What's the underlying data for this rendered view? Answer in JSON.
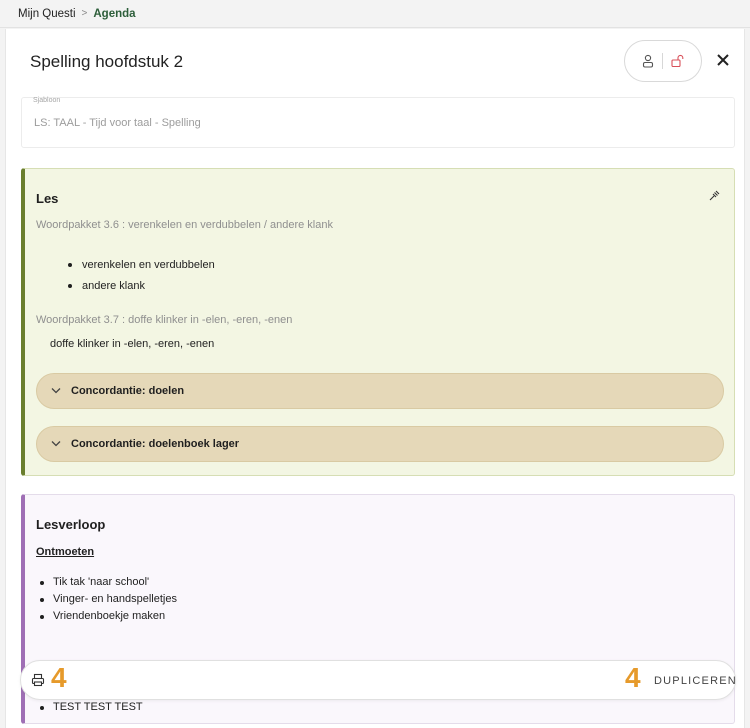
{
  "breadcrumb": {
    "root": "Mijn Questi",
    "separator": ">",
    "current": "Agenda"
  },
  "header": {
    "title": "Spelling hoofdstuk 2"
  },
  "template_field": {
    "label": "Sjabloon",
    "value": "LS: TAAL - Tijd voor taal - Spelling"
  },
  "les": {
    "title": "Les",
    "group1_title": "Woordpakket 3.6 : verenkelen en verdubbelen / andere klank",
    "group1_items": [
      "verenkelen en verdubbelen",
      "andere klank"
    ],
    "group2_title": "Woordpakket 3.7 : doffe klinker in -elen, -eren, -enen",
    "group2_text": "doffe klinker in -elen, -eren, -enen",
    "accordions": [
      "Concordantie: doelen",
      "Concordantie: doelenboek lager"
    ]
  },
  "lesverloop": {
    "title": "Lesverloop",
    "section": "Ontmoeten",
    "items": [
      "Tik tak 'naar school'",
      "Vinger- en handspelletjes",
      "Vriendenboekje maken"
    ],
    "trailing_item": "TEST TEST TEST"
  },
  "footer": {
    "left_count": "4",
    "right_count": "4",
    "duplicate_label": "DUPLICEREN"
  },
  "colors": {
    "accent_green": "#2d5e3a",
    "les_border": "#6a7e2e",
    "lesverloop_border": "#9f6fb5",
    "count_orange": "#e69a2b",
    "accordion_bg": "#e5d8b8"
  }
}
